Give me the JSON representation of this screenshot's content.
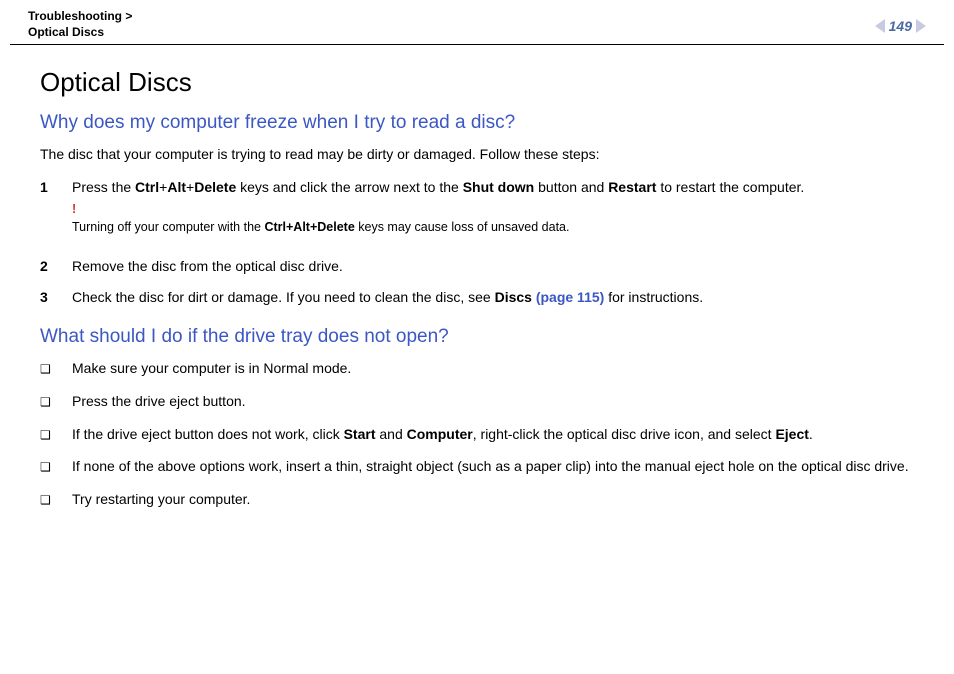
{
  "header": {
    "crumb_line1": "Troubleshooting >",
    "crumb_line2": "Optical Discs",
    "page_number": "149"
  },
  "title": "Optical Discs",
  "q1": {
    "heading": "Why does my computer freeze when I try to read a disc?",
    "intro": "The disc that your computer is trying to read may be dirty or damaged. Follow these steps:",
    "step1": {
      "num": "1",
      "pre": "Press the ",
      "k1": "Ctrl",
      "p1": "+",
      "k2": "Alt",
      "p2": "+",
      "k3": "Delete",
      "mid": " keys and click the arrow next to the ",
      "k4": "Shut down",
      "mid2": " button and ",
      "k5": "Restart",
      "post": " to restart the computer."
    },
    "warn": {
      "bang": "!",
      "pre": "Turning off your computer with the ",
      "k": "Ctrl+Alt+Delete",
      "post": " keys may cause loss of unsaved data."
    },
    "step2": {
      "num": "2",
      "text": "Remove the disc from the optical disc drive."
    },
    "step3": {
      "num": "3",
      "pre": "Check the disc for dirt or damage. If you need to clean the disc, see ",
      "bold": "Discs ",
      "link": "(page 115)",
      "post": " for instructions."
    }
  },
  "q2": {
    "heading": "What should I do if the drive tray does not open?",
    "b1": "Make sure your computer is in Normal mode.",
    "b2": "Press the drive eject button.",
    "b3": {
      "pre": "If the drive eject button does not work, click ",
      "k1": "Start",
      "mid": " and ",
      "k2": "Computer",
      "mid2": ", right-click the optical disc drive icon, and select ",
      "k3": "Eject",
      "post": "."
    },
    "b4": "If none of the above options work, insert a thin, straight object (such as a paper clip) into the manual eject hole on the optical disc drive.",
    "b5": "Try restarting your computer."
  },
  "glyph": {
    "square": "❑"
  }
}
